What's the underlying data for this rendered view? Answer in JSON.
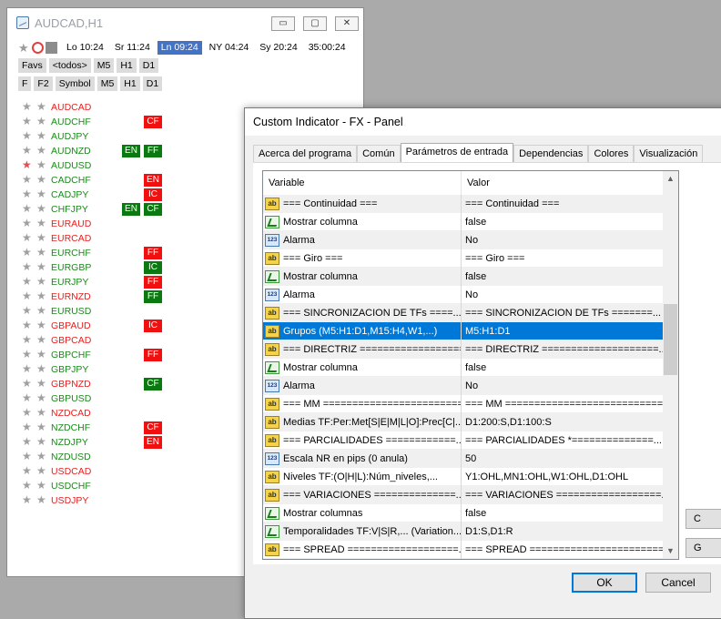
{
  "chart_window": {
    "title": "AUDCAD,H1",
    "controls": {
      "minimize": "▭",
      "maximize": "▢",
      "close": "✕"
    },
    "sessions": [
      {
        "label": "Lo 10:24",
        "active": false
      },
      {
        "label": "Sr 11:24",
        "active": false
      },
      {
        "label": "Ln 09:24",
        "active": true
      },
      {
        "label": "NY 04:24",
        "active": false
      },
      {
        "label": "Sy 20:24",
        "active": false
      },
      {
        "label": "35:00:24",
        "active": false
      }
    ],
    "toolbar_row2": [
      "Favs",
      "<todos>",
      "M5",
      "H1",
      "D1"
    ],
    "toolbar_row3": [
      "F",
      "F2",
      "Symbol",
      "M5",
      "H1",
      "D1"
    ],
    "symbols": [
      {
        "name": "AUDCAD",
        "color": "red",
        "fav": false,
        "c1": null,
        "c2": null
      },
      {
        "name": "AUDCHF",
        "color": "green",
        "fav": false,
        "c1": null,
        "c2": {
          "t": "CF",
          "c": "r"
        }
      },
      {
        "name": "AUDJPY",
        "color": "green",
        "fav": false,
        "c1": null,
        "c2": null
      },
      {
        "name": "AUDNZD",
        "color": "green",
        "fav": false,
        "c1": {
          "t": "EN",
          "c": "g"
        },
        "c2": {
          "t": "FF",
          "c": "g"
        }
      },
      {
        "name": "AUDUSD",
        "color": "green",
        "fav": true,
        "c1": null,
        "c2": null
      },
      {
        "name": "CADCHF",
        "color": "green",
        "fav": false,
        "c1": null,
        "c2": {
          "t": "EN",
          "c": "r"
        }
      },
      {
        "name": "CADJPY",
        "color": "green",
        "fav": false,
        "c1": null,
        "c2": {
          "t": "IC",
          "c": "r"
        }
      },
      {
        "name": "CHFJPY",
        "color": "green",
        "fav": false,
        "c1": {
          "t": "EN",
          "c": "g"
        },
        "c2": {
          "t": "CF",
          "c": "g"
        }
      },
      {
        "name": "EURAUD",
        "color": "red",
        "fav": false,
        "c1": null,
        "c2": null
      },
      {
        "name": "EURCAD",
        "color": "red",
        "fav": false,
        "c1": null,
        "c2": null
      },
      {
        "name": "EURCHF",
        "color": "green",
        "fav": false,
        "c1": null,
        "c2": {
          "t": "FF",
          "c": "r"
        }
      },
      {
        "name": "EURGBP",
        "color": "green",
        "fav": false,
        "c1": null,
        "c2": {
          "t": "IC",
          "c": "g"
        }
      },
      {
        "name": "EURJPY",
        "color": "green",
        "fav": false,
        "c1": null,
        "c2": {
          "t": "FF",
          "c": "r"
        }
      },
      {
        "name": "EURNZD",
        "color": "red",
        "fav": false,
        "c1": null,
        "c2": {
          "t": "FF",
          "c": "g"
        }
      },
      {
        "name": "EURUSD",
        "color": "green",
        "fav": false,
        "c1": null,
        "c2": null
      },
      {
        "name": "GBPAUD",
        "color": "red",
        "fav": false,
        "c1": null,
        "c2": {
          "t": "IC",
          "c": "r"
        }
      },
      {
        "name": "GBPCAD",
        "color": "red",
        "fav": false,
        "c1": null,
        "c2": null
      },
      {
        "name": "GBPCHF",
        "color": "green",
        "fav": false,
        "c1": null,
        "c2": {
          "t": "FF",
          "c": "r"
        }
      },
      {
        "name": "GBPJPY",
        "color": "green",
        "fav": false,
        "c1": null,
        "c2": null
      },
      {
        "name": "GBPNZD",
        "color": "red",
        "fav": false,
        "c1": null,
        "c2": {
          "t": "CF",
          "c": "g"
        }
      },
      {
        "name": "GBPUSD",
        "color": "green",
        "fav": false,
        "c1": null,
        "c2": null
      },
      {
        "name": "NZDCAD",
        "color": "red",
        "fav": false,
        "c1": null,
        "c2": null
      },
      {
        "name": "NZDCHF",
        "color": "green",
        "fav": false,
        "c1": null,
        "c2": {
          "t": "CF",
          "c": "r"
        }
      },
      {
        "name": "NZDJPY",
        "color": "green",
        "fav": false,
        "c1": null,
        "c2": {
          "t": "EN",
          "c": "r"
        }
      },
      {
        "name": "NZDUSD",
        "color": "green",
        "fav": false,
        "c1": null,
        "c2": null
      },
      {
        "name": "USDCAD",
        "color": "red",
        "fav": false,
        "c1": null,
        "c2": null
      },
      {
        "name": "USDCHF",
        "color": "green",
        "fav": false,
        "c1": null,
        "c2": null
      },
      {
        "name": "USDJPY",
        "color": "red",
        "fav": false,
        "c1": null,
        "c2": null
      }
    ]
  },
  "dialog": {
    "title": "Custom Indicator - FX - Panel",
    "tabs": [
      {
        "label": "Acerca del programa",
        "selected": false
      },
      {
        "label": "Común",
        "selected": false
      },
      {
        "label": "Parámetros de entrada",
        "selected": true
      },
      {
        "label": "Dependencias",
        "selected": false
      },
      {
        "label": "Colores",
        "selected": false
      },
      {
        "label": "Visualización",
        "selected": false
      }
    ],
    "grid_headers": {
      "variable": "Variable",
      "value": "Valor"
    },
    "rows": [
      {
        "icon": "ab",
        "variable": "=== Continuidad ===",
        "value": "=== Continuidad ===",
        "sel": false
      },
      {
        "icon": "flag",
        "variable": "Mostrar columna",
        "value": "false",
        "sel": false
      },
      {
        "icon": "num",
        "variable": "Alarma",
        "value": "No",
        "sel": false
      },
      {
        "icon": "ab",
        "variable": "=== Giro ===",
        "value": "=== Giro ===",
        "sel": false
      },
      {
        "icon": "flag",
        "variable": "Mostrar columna",
        "value": "false",
        "sel": false
      },
      {
        "icon": "num",
        "variable": "Alarma",
        "value": "No",
        "sel": false
      },
      {
        "icon": "ab",
        "variable": "=== SINCRONIZACION DE TFs ====...",
        "value": "=== SINCRONIZACION DE TFs =======...",
        "sel": false
      },
      {
        "icon": "ab",
        "variable": "Grupos (M5:H1:D1,M15:H4,W1,...)",
        "value": "M5:H1:D1",
        "sel": true
      },
      {
        "icon": "ab",
        "variable": "=== DIRECTRIZ ==================...",
        "value": "=== DIRECTRIZ ====================...",
        "sel": false
      },
      {
        "icon": "flag",
        "variable": "Mostrar columna",
        "value": "false",
        "sel": false
      },
      {
        "icon": "num",
        "variable": "Alarma",
        "value": "No",
        "sel": false
      },
      {
        "icon": "ab",
        "variable": "=== MM ========================...",
        "value": "=== MM ===========================...",
        "sel": false
      },
      {
        "icon": "ab",
        "variable": "Medias TF:Per:Met[S|E|M|L|O]:Prec[C|...",
        "value": "D1:200:S,D1:100:S",
        "sel": false
      },
      {
        "icon": "ab",
        "variable": "=== PARCIALIDADES ============...",
        "value": "=== PARCIALIDADES *==============...",
        "sel": false
      },
      {
        "icon": "num",
        "variable": "Escala NR en pips (0 anula)",
        "value": "50",
        "sel": false
      },
      {
        "icon": "ab",
        "variable": "Niveles TF:(O|H|L):Núm_niveles,...",
        "value": "Y1:OHL,MN1:OHL,W1:OHL,D1:OHL",
        "sel": false
      },
      {
        "icon": "ab",
        "variable": "=== VARIACIONES ==============...",
        "value": "=== VARIACIONES ==================...",
        "sel": false
      },
      {
        "icon": "flag",
        "variable": "Mostrar columnas",
        "value": "false",
        "sel": false
      },
      {
        "icon": "flag",
        "variable": "Temporalidades TF:V|S|R,... (Variation...",
        "value": "D1:S,D1:R",
        "sel": false
      },
      {
        "icon": "ab",
        "variable": "=== SPREAD ===================...",
        "value": "=== SPREAD =======================...",
        "sel": false
      }
    ],
    "side_buttons": [
      "C",
      "G"
    ],
    "ok_label": "OK",
    "cancel_label": "Cancel"
  }
}
